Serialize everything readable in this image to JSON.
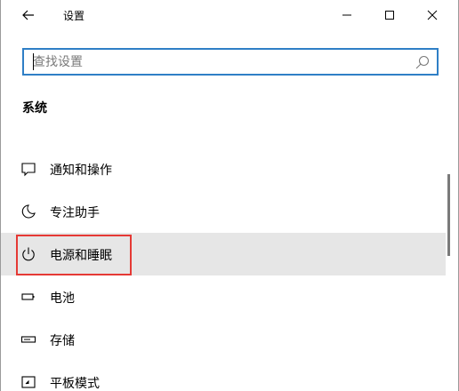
{
  "window": {
    "title": "设置"
  },
  "search": {
    "placeholder": "查找设置"
  },
  "section": {
    "title": "系统"
  },
  "nav": {
    "items": [
      {
        "label": "通知和操作",
        "icon": "notification-icon"
      },
      {
        "label": "专注助手",
        "icon": "moon-icon"
      },
      {
        "label": "电源和睡眠",
        "icon": "power-icon",
        "selected": true
      },
      {
        "label": "电池",
        "icon": "battery-icon"
      },
      {
        "label": "存储",
        "icon": "storage-icon"
      },
      {
        "label": "平板模式",
        "icon": "tablet-icon"
      }
    ]
  },
  "colors": {
    "accent": "#2f7fc6",
    "selected_bg": "#e6e6e6",
    "annotation": "#e53935"
  }
}
